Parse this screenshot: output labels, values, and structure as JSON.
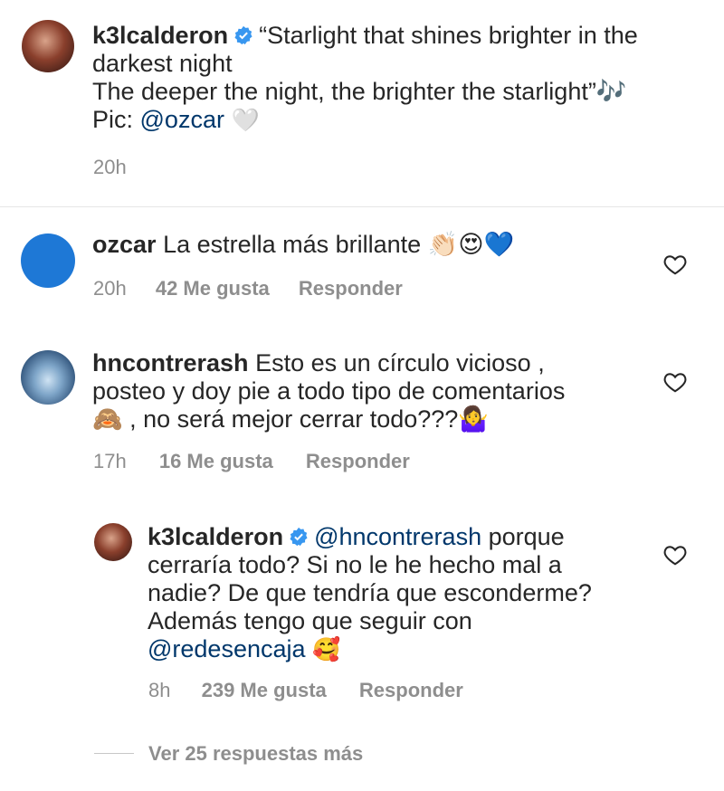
{
  "caption": {
    "username": "k3lcalderon",
    "lines": [
      "“Starlight that shines brighter in the",
      "darkest night",
      "The deeper the night, the brighter the starlight”🎶"
    ],
    "pic_label": "Pic: ",
    "pic_mention": "@ozcar",
    "pic_emoji": "🤍",
    "time": "20h"
  },
  "comments": [
    {
      "username": "ozcar",
      "text": "La estrella más brillante 👏🏻😍💙",
      "time": "20h",
      "likes": "42 Me gusta",
      "reply_label": "Responder"
    },
    {
      "username": "hncontrerash",
      "lines": [
        "Esto es un círculo vicioso ,",
        "posteo y doy pie a todo tipo de comentarios",
        "🙈 , no será mejor cerrar todo???🤷‍♀️"
      ],
      "time": "17h",
      "likes": "16 Me gusta",
      "reply_label": "Responder"
    }
  ],
  "reply": {
    "username": "k3lcalderon",
    "mention": "@hncontrerash",
    "first_line_rest": " porque",
    "lines": [
      "cerraría todo? Si no le he hecho mal a",
      "nadie? De que tendría que esconderme?",
      "Además tengo que seguir con"
    ],
    "last_mention": "@redesencaja",
    "last_emoji": "🥰",
    "time": "8h",
    "likes": "239 Me gusta",
    "reply_label": "Responder"
  },
  "view_more": "Ver 25 respuestas más",
  "colors": {
    "text": "#262626",
    "secondary": "#8e8e8e",
    "link": "#00376b",
    "verified": "#3897f0",
    "ozcar_avatar": "#1e78d6"
  },
  "icons": [
    "verified-badge-icon",
    "heart-icon"
  ]
}
